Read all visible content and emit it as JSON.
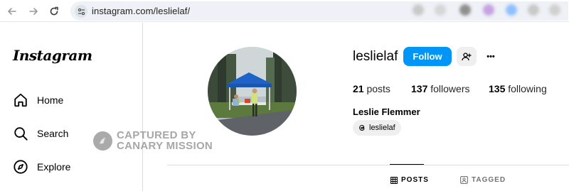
{
  "browser": {
    "url": "instagram.com/leslielaf/",
    "extension_colors": [
      "#c9c9c9",
      "#d6d6d6",
      "#8f8f8f",
      "#c6a3e0",
      "#8fc0ff",
      "#c8c8c8",
      "#d0d0d0"
    ]
  },
  "sidebar": {
    "brand": "Instagram",
    "items": [
      {
        "label": "Home",
        "icon": "home-icon"
      },
      {
        "label": "Search",
        "icon": "search-icon"
      },
      {
        "label": "Explore",
        "icon": "compass-icon"
      }
    ]
  },
  "watermark": {
    "line1": "CAPTURED BY",
    "line2": "CANARY MISSION"
  },
  "profile": {
    "username": "leslielaf",
    "follow_label": "Follow",
    "more_label": "•••",
    "posts_count": "21",
    "posts_label": "posts",
    "followers_count": "137",
    "followers_label": "followers",
    "following_count": "135",
    "following_label": "following",
    "full_name": "Leslie Flemmer",
    "threads_handle": "leslielaf"
  },
  "tabs": [
    {
      "label": "POSTS",
      "active": true
    },
    {
      "label": "TAGGED",
      "active": false
    }
  ],
  "colors": {
    "accent": "#0095f6",
    "divider": "#dbdbdb",
    "tent": "#1f63c8"
  }
}
